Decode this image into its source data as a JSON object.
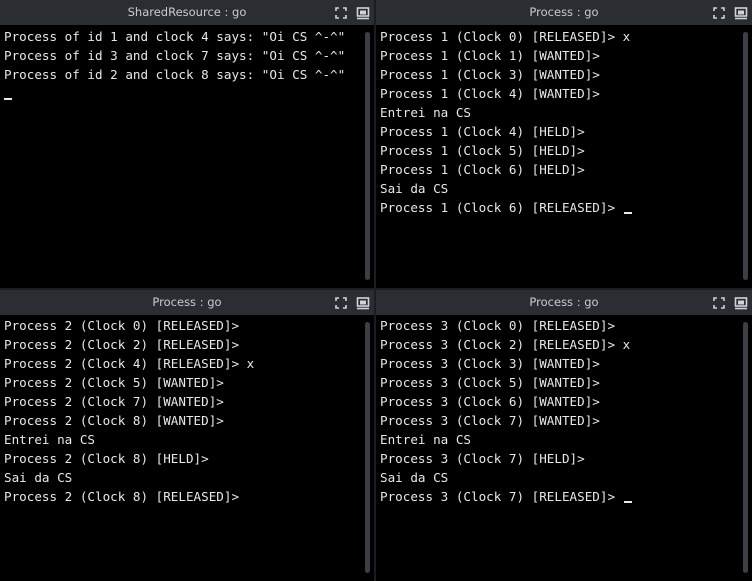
{
  "panes": [
    {
      "title": "SharedResource : go",
      "lines": [
        "Process of id 1 and clock 4 says: \"Oi CS ^-^\"",
        "Process of id 3 and clock 7 says: \"Oi CS ^-^\"",
        "Process of id 2 and clock 8 says: \"Oi CS ^-^\"",
        ""
      ]
    },
    {
      "title": "Process : go",
      "lines": [
        "Process 1 (Clock 0) [RELEASED]> x",
        "Process 1 (Clock 1) [WANTED]>",
        "Process 1 (Clock 3) [WANTED]>",
        "Process 1 (Clock 4) [WANTED]>",
        "Entrei na CS",
        "Process 1 (Clock 4) [HELD]>",
        "Process 1 (Clock 5) [HELD]>",
        "Process 1 (Clock 6) [HELD]>",
        "Sai da CS",
        "Process 1 (Clock 6) [RELEASED]> "
      ]
    },
    {
      "title": "Process : go",
      "lines": [
        "Process 2 (Clock 0) [RELEASED]>",
        "Process 2 (Clock 2) [RELEASED]>",
        "Process 2 (Clock 4) [RELEASED]> x",
        "Process 2 (Clock 5) [WANTED]>",
        "Process 2 (Clock 7) [WANTED]>",
        "Process 2 (Clock 8) [WANTED]>",
        "Entrei na CS",
        "Process 2 (Clock 8) [HELD]>",
        "Sai da CS",
        "Process 2 (Clock 8) [RELEASED]>"
      ]
    },
    {
      "title": "Process : go",
      "lines": [
        "Process 3 (Clock 0) [RELEASED]>",
        "Process 3 (Clock 2) [RELEASED]> x",
        "Process 3 (Clock 3) [WANTED]>",
        "Process 3 (Clock 5) [WANTED]>",
        "Process 3 (Clock 6) [WANTED]>",
        "Process 3 (Clock 7) [WANTED]>",
        "Entrei na CS",
        "Process 3 (Clock 7) [HELD]>",
        "Sai da CS",
        "Process 3 (Clock 7) [RELEASED]> "
      ]
    }
  ]
}
